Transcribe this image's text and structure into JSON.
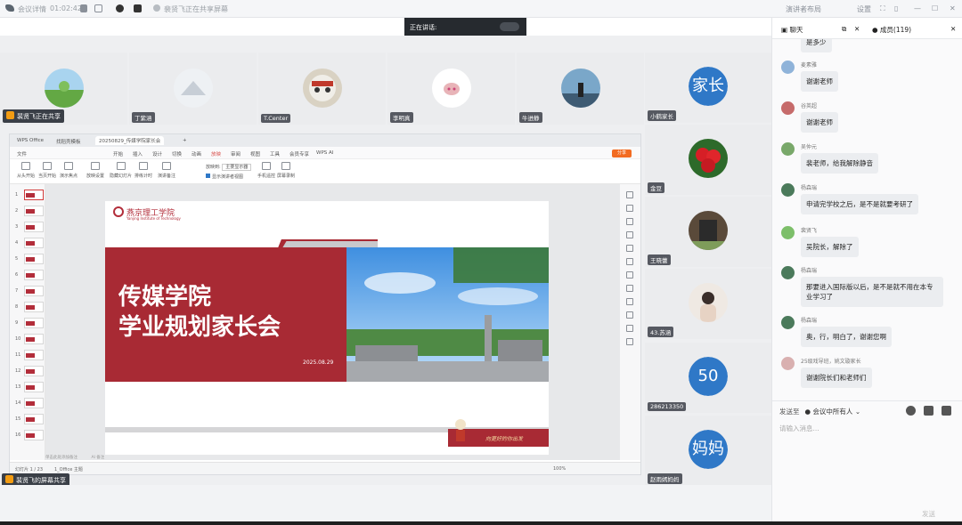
{
  "topbar": {
    "app_title": "会议详情",
    "duration": "01:02:42",
    "sharing_notice": "裴贤飞正在共享屏幕"
  },
  "topbar_right": {
    "layout": "演讲者布局",
    "settings": "设置"
  },
  "speaking": {
    "label": "正在讲话:"
  },
  "participants_top": [
    {
      "name": "裴贤飞正在共享"
    },
    {
      "name": "丁紫涵"
    },
    {
      "name": "T.Center"
    },
    {
      "name": "李明真"
    },
    {
      "name": "牛进静"
    }
  ],
  "participants_right": [
    {
      "name": "小鹤家长",
      "avatar_text": "家长"
    },
    {
      "name": "金豆"
    },
    {
      "name": "王晓蕾"
    },
    {
      "name": "43.苏涵"
    },
    {
      "name": "286213350",
      "avatar_text": "50"
    },
    {
      "name": "赵雨嫣妈妈",
      "avatar_text": "妈妈"
    }
  ],
  "share_label": "裴贤飞的屏幕共享",
  "wps": {
    "tabs": [
      "WPS Office",
      "找稻壳模板",
      "20250829_传媒学院家长会"
    ],
    "menu": [
      "文件",
      "开始",
      "插入",
      "设计",
      "切换",
      "动画",
      "放映",
      "审阅",
      "视图",
      "工具",
      "会员专享",
      "WPS AI"
    ],
    "active_menu": "放映",
    "share_button": "分享",
    "ribbon": [
      "从头开始",
      "当页开始",
      "演示焦点",
      "放映设置",
      "隐藏幻灯片",
      "排练计时",
      "演讲备注",
      "显示演讲者视图",
      "手机遥控",
      "屏幕录制"
    ],
    "ribbon_extra": {
      "monitor_label": "放映到:",
      "monitor_value": "主要显示器"
    },
    "slide_count": 16,
    "status": {
      "slide_pos": "幻灯片 1 / 23",
      "theme": "1_Office 主题",
      "note": "单击此处添加备注",
      "zoom": "100%",
      "ai": "AI 备注"
    }
  },
  "slide": {
    "school_name": "燕京理工学院",
    "school_sub": "Yanjing Institute of Technology",
    "title_line1": "传媒学院",
    "title_line2": "学业规划家长会",
    "date": "2025.08.29",
    "motto": "向更好的你出发"
  },
  "chat": {
    "tab_chat": "聊天",
    "tab_members": "成员(119)",
    "messages": [
      {
        "sender": "",
        "text": "是多少"
      },
      {
        "sender": "麦素雅",
        "text": "谢谢老师"
      },
      {
        "sender": "谷英超",
        "text": "谢谢老师"
      },
      {
        "sender": "吴仲元",
        "text": "裴老师，给我解除静音"
      },
      {
        "sender": "杨森瑞",
        "text": "申请完学校之后，是不是就要考研了"
      },
      {
        "sender": "裴贤飞",
        "text": "吴院长，解除了"
      },
      {
        "sender": "杨森瑞",
        "text": "那要进入国际版以后，是不是就不用在本专业学习了"
      },
      {
        "sender": "杨森瑞",
        "text": "奥，行，明白了，谢谢您啊"
      },
      {
        "sender": "25级戏导班，姚文璇家长",
        "text": "谢谢院长们和老师们"
      }
    ],
    "send_to_label": "发送至",
    "send_to_value": "会议中所有人",
    "input_placeholder": "请输入消息...",
    "send_button": "发送"
  },
  "colors": {
    "brand_red": "#a82a34",
    "avatar_blue": "#2f78c7",
    "share_orange": "#f26b21"
  }
}
